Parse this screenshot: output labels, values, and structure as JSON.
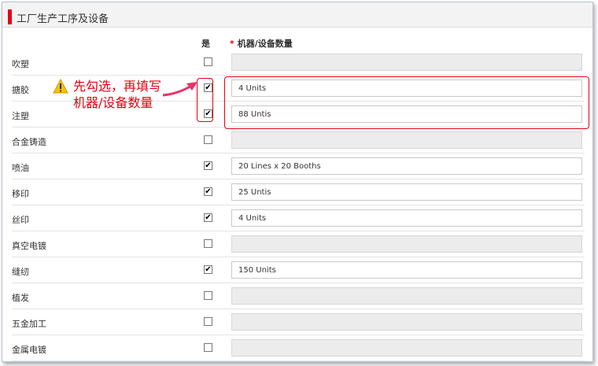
{
  "section": {
    "title": "工厂生产工序及设备"
  },
  "columns": {
    "yes": "是",
    "required_mark": "*",
    "quantity": "机器/设备数量"
  },
  "callout": {
    "line1": "先勾选，再填写",
    "line2": "机器/设备数量"
  },
  "rows": [
    {
      "label": "吹塑",
      "checked": false,
      "value": ""
    },
    {
      "label": "搪胶",
      "checked": true,
      "value": "4 Units"
    },
    {
      "label": "注塑",
      "checked": true,
      "value": "88 Untis"
    },
    {
      "label": "合金铸造",
      "checked": false,
      "value": ""
    },
    {
      "label": "喷油",
      "checked": true,
      "value": "20 Lines x 20 Booths"
    },
    {
      "label": "移印",
      "checked": true,
      "value": "25 Untis"
    },
    {
      "label": "丝印",
      "checked": true,
      "value": "4 Units"
    },
    {
      "label": "真空电镀",
      "checked": false,
      "value": ""
    },
    {
      "label": "缝纫",
      "checked": true,
      "value": "150 Units"
    },
    {
      "label": "植发",
      "checked": false,
      "value": ""
    },
    {
      "label": "五金加工",
      "checked": false,
      "value": ""
    },
    {
      "label": "金属电镀",
      "checked": false,
      "value": ""
    }
  ],
  "colors": {
    "accent": "#e60012",
    "disabled_field": "#ececec",
    "header_bg": "#f3f3f3"
  }
}
